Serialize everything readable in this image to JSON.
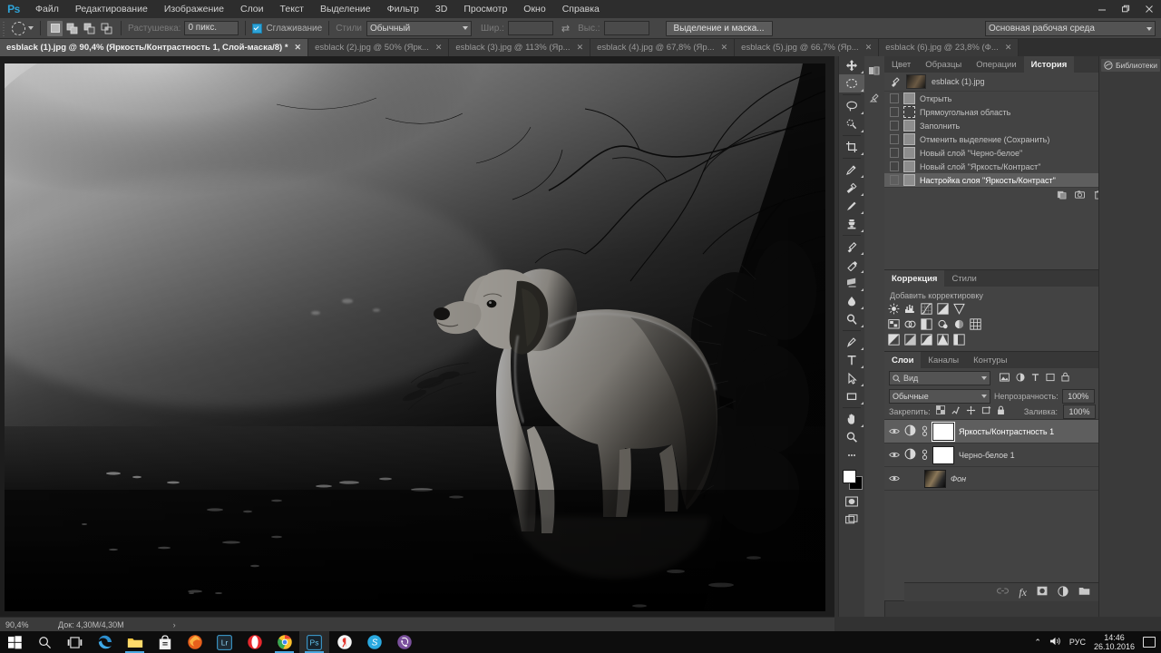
{
  "app": {
    "logo": "Ps",
    "title": "Adobe Photoshop"
  },
  "menubar": {
    "items": [
      "Файл",
      "Редактирование",
      "Изображение",
      "Слои",
      "Текст",
      "Выделение",
      "Фильтр",
      "3D",
      "Просмотр",
      "Окно",
      "Справка"
    ]
  },
  "window_controls": {
    "minimize": "—",
    "restore": "❐",
    "close": "✕"
  },
  "options_bar": {
    "tool_name": "elliptical-marquee",
    "bool_modes": [
      "new-selection",
      "add-to-selection",
      "subtract-from-selection",
      "intersect-selection"
    ],
    "active_bool_mode": 0,
    "feather_label": "Растушевка:",
    "feather_value": "0 пикс.",
    "antialias_label": "Сглаживание",
    "antialias_checked": true,
    "style_label": "Стили",
    "style_value": "Обычный",
    "width_label": "Шир.:",
    "width_value": "",
    "height_label": "Выс.:",
    "height_value": "",
    "swap_icon": "swap-arrows",
    "select_mask_button": "Выделение и маска...",
    "workspace": "Основная рабочая среда"
  },
  "document_tabs": [
    {
      "label": "esblack (1).jpg @ 90,4% (Яркость/Контрастность 1, Слой-маска/8) *",
      "active": true,
      "close": "✕"
    },
    {
      "label": "esblack (2).jpg @ 50% (Ярк...",
      "active": false,
      "close": "✕"
    },
    {
      "label": "esblack (3).jpg @ 113% (Яр...",
      "active": false,
      "close": "✕"
    },
    {
      "label": "esblack (4).jpg @ 67,8% (Яр...",
      "active": false,
      "close": "✕"
    },
    {
      "label": "esblack (5).jpg @ 66,7% (Яр...",
      "active": false,
      "close": "✕"
    },
    {
      "label": "esblack (6).jpg @ 23,8% (Ф...",
      "active": false,
      "close": "✕"
    }
  ],
  "status_bar": {
    "zoom": "90,4%",
    "doc_size": "Док: 4,30M/4,30M",
    "arrow": "›"
  },
  "tools": [
    {
      "name": "move-tool",
      "has_submenu": true,
      "selected": false
    },
    {
      "name": "elliptical-marquee-tool",
      "has_submenu": true,
      "selected": true
    },
    {
      "name": "lasso-tool",
      "has_submenu": true,
      "selected": false
    },
    {
      "name": "quick-selection-tool",
      "has_submenu": true,
      "selected": false
    },
    {
      "name": "crop-tool",
      "has_submenu": true,
      "selected": false
    },
    {
      "name": "eyedropper-tool",
      "has_submenu": true,
      "selected": false
    },
    {
      "name": "healing-brush-tool",
      "has_submenu": true,
      "selected": false
    },
    {
      "name": "brush-tool",
      "has_submenu": true,
      "selected": false
    },
    {
      "name": "clone-stamp-tool",
      "has_submenu": true,
      "selected": false
    },
    {
      "name": "history-brush-tool",
      "has_submenu": true,
      "selected": false
    },
    {
      "name": "eraser-tool",
      "has_submenu": true,
      "selected": false
    },
    {
      "name": "gradient-tool",
      "has_submenu": true,
      "selected": false
    },
    {
      "name": "blur-tool",
      "has_submenu": true,
      "selected": false
    },
    {
      "name": "dodge-tool",
      "has_submenu": true,
      "selected": false
    },
    {
      "name": "pen-tool",
      "has_submenu": true,
      "selected": false
    },
    {
      "name": "type-tool",
      "has_submenu": true,
      "selected": false
    },
    {
      "name": "path-selection-tool",
      "has_submenu": true,
      "selected": false
    },
    {
      "name": "rectangle-tool",
      "has_submenu": true,
      "selected": false
    },
    {
      "name": "hand-tool",
      "has_submenu": true,
      "selected": false
    },
    {
      "name": "zoom-tool",
      "has_submenu": false,
      "selected": false
    },
    {
      "name": "edit-toolbar-ellipsis",
      "has_submenu": false,
      "selected": false
    }
  ],
  "history_panel": {
    "tabs": [
      {
        "label": "Цвет",
        "active": false
      },
      {
        "label": "Образцы",
        "active": false
      },
      {
        "label": "Операции",
        "active": false
      },
      {
        "label": "История",
        "active": true
      }
    ],
    "snapshot": "esblack (1).jpg",
    "states": [
      {
        "label": "Открыть",
        "icon": "document-icon",
        "active": false
      },
      {
        "label": "Прямоугольная область",
        "icon": "marquee-icon",
        "active": false
      },
      {
        "label": "Заполнить",
        "icon": "fill-icon",
        "active": false
      },
      {
        "label": "Отменить выделение (Сохранить)",
        "icon": "document-icon",
        "active": false
      },
      {
        "label": "Новый слой \"Черно-белое\"",
        "icon": "document-icon",
        "active": false
      },
      {
        "label": "Новый слой \"Яркость/Контраст\"",
        "icon": "document-icon",
        "active": false
      },
      {
        "label": "Настройка слоя \"Яркость/Контраст\"",
        "icon": "document-icon",
        "active": true
      }
    ],
    "footer_buttons": [
      "create-document-from-state-icon",
      "create-snapshot-icon",
      "delete-icon"
    ]
  },
  "adjustments_panel": {
    "tabs": [
      {
        "label": "Коррекция",
        "active": true
      },
      {
        "label": "Стили",
        "active": false
      }
    ],
    "title": "Добавить корректировку",
    "rows": [
      [
        "brightness-contrast-icon",
        "levels-icon",
        "curves-icon",
        "exposure-icon",
        "vibrance-icon"
      ],
      [
        "hue-saturation-icon",
        "color-balance-icon",
        "black-white-icon",
        "photo-filter-icon",
        "channel-mixer-icon",
        "color-lookup-icon"
      ],
      [
        "invert-icon",
        "posterize-icon",
        "threshold-icon",
        "gradient-map-icon",
        "selective-color-icon"
      ]
    ]
  },
  "layers_panel": {
    "tabs": [
      {
        "label": "Слои",
        "active": true
      },
      {
        "label": "Каналы",
        "active": false
      },
      {
        "label": "Контуры",
        "active": false
      }
    ],
    "filter_label": "Вид",
    "filter_icons": [
      "pixel-filter-icon",
      "adjustment-filter-icon",
      "type-filter-icon",
      "shape-filter-icon",
      "smart-object-filter-icon"
    ],
    "blend_mode": "Обычные",
    "opacity_label": "Непрозрачность:",
    "opacity_value": "100%",
    "lock_label": "Закрепить:",
    "lock_icons": [
      "lock-transparent-icon",
      "lock-image-icon",
      "lock-position-icon",
      "lock-artboard-icon",
      "lock-all-icon"
    ],
    "fill_label": "Заливка:",
    "fill_value": "100%",
    "layers": [
      {
        "name": "Яркость/Контрастность 1",
        "type": "adjustment",
        "visible": true,
        "active": true,
        "locked": false
      },
      {
        "name": "Черно-белое 1",
        "type": "adjustment",
        "visible": true,
        "active": false,
        "locked": false
      },
      {
        "name": "Фон",
        "type": "image",
        "visible": true,
        "active": false,
        "locked": true
      }
    ],
    "footer_buttons": [
      "link-layers-icon",
      "layer-style-fx-icon",
      "add-mask-icon",
      "new-adjustment-layer-icon",
      "new-group-icon",
      "new-layer-icon",
      "delete-layer-icon"
    ]
  },
  "libraries_panel": {
    "label": "Библиотеки",
    "icon": "libraries-icon"
  },
  "icon_rail": [
    "color-panel-icon",
    "history-brush-panel-icon"
  ],
  "canvas": {
    "description": "Чёрно-белая фотография собаки, стоящей в воде у тёмных ветвей",
    "zoom": "90,4%"
  },
  "taskbar": {
    "start": "windows-start-icon",
    "items": [
      {
        "name": "search-icon",
        "running": false,
        "focus": false
      },
      {
        "name": "task-view-icon",
        "running": false,
        "focus": false
      },
      {
        "name": "edge-icon",
        "running": false,
        "focus": false
      },
      {
        "name": "file-explorer-icon",
        "running": true,
        "focus": false
      },
      {
        "name": "store-icon",
        "running": false,
        "focus": false
      },
      {
        "name": "firefox-icon",
        "running": false,
        "focus": false
      },
      {
        "name": "lightroom-icon",
        "running": false,
        "focus": false
      },
      {
        "name": "opera-icon",
        "running": false,
        "focus": false
      },
      {
        "name": "chrome-icon",
        "running": true,
        "focus": false
      },
      {
        "name": "photoshop-icon",
        "running": true,
        "focus": true
      },
      {
        "name": "yandex-browser-icon",
        "running": false,
        "focus": false
      },
      {
        "name": "skype-icon",
        "running": false,
        "focus": false
      },
      {
        "name": "viber-icon",
        "running": false,
        "focus": false
      }
    ],
    "tray": {
      "chevron": "⌃",
      "volume": "volume-icon",
      "language": "РУС",
      "time": "14:46",
      "date": "26.10.2016",
      "action_center": "notifications-icon"
    }
  }
}
